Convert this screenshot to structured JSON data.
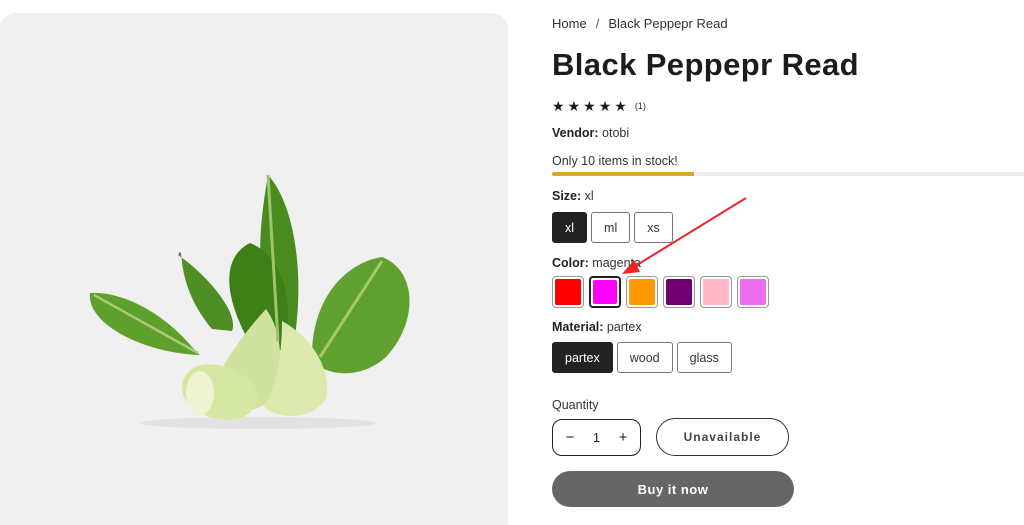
{
  "breadcrumb": {
    "home": "Home",
    "separator": "/",
    "current": "Black Peppepr Read"
  },
  "product": {
    "title": "Black Peppepr Read",
    "image_icon": "bok-choy-image",
    "rating": {
      "stars": "★★★★★",
      "value": 5,
      "max": 5,
      "count": "(1)"
    },
    "vendor": {
      "label": "Vendor:",
      "value": "otobi"
    },
    "stock": {
      "text": "Only 10 items in stock!",
      "fraction": 0.3,
      "bar_color": "#d8a631"
    }
  },
  "options": {
    "size": {
      "label": "Size:",
      "selected": "xl",
      "values": [
        "xl",
        "ml",
        "xs"
      ]
    },
    "color": {
      "label": "Color:",
      "selected": "magenta",
      "swatches": [
        {
          "name": "red",
          "hex": "#ff0000"
        },
        {
          "name": "magenta",
          "hex": "#ff00ff"
        },
        {
          "name": "orange",
          "hex": "#ff9b00"
        },
        {
          "name": "purple",
          "hex": "#700070"
        },
        {
          "name": "pink",
          "hex": "#ffb6c8"
        },
        {
          "name": "violet",
          "hex": "#ec6ef0"
        }
      ]
    },
    "material": {
      "label": "Material:",
      "selected": "partex",
      "values": [
        "partex",
        "wood",
        "glass"
      ]
    }
  },
  "quantity": {
    "label": "Quantity",
    "value": "1",
    "minus": "−",
    "plus": "+"
  },
  "buttons": {
    "unavailable": "Unavailable",
    "buy_now": "Buy it now"
  },
  "annotation": {
    "color": "#e8252a"
  }
}
